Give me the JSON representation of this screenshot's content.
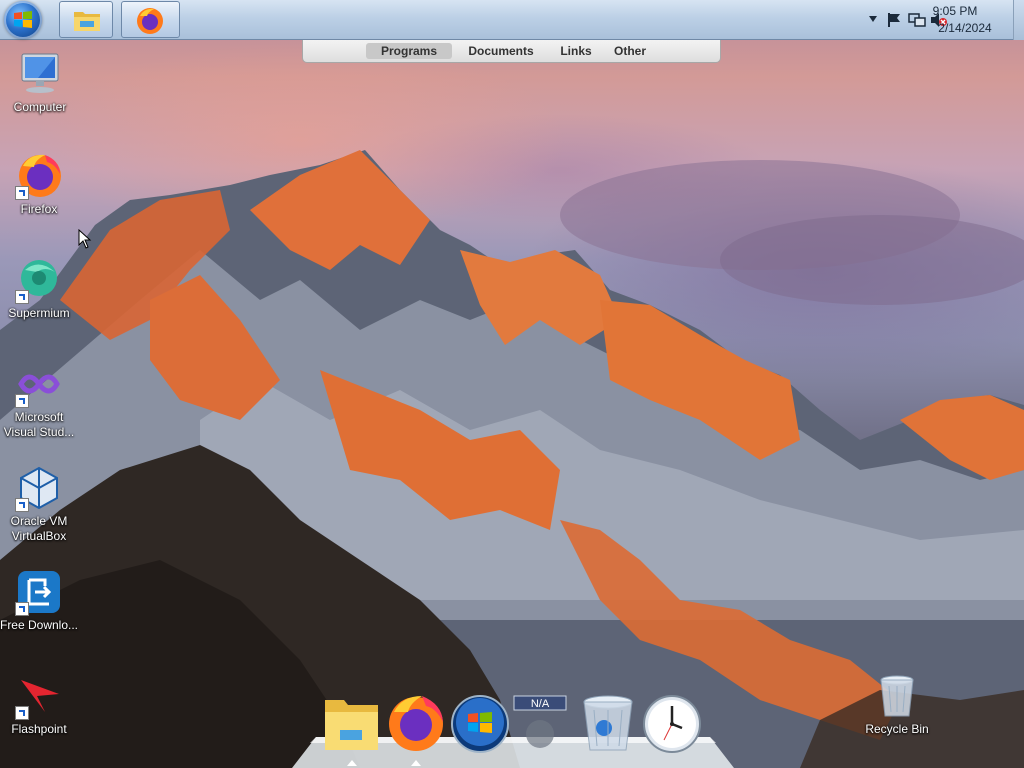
{
  "taskbar": {
    "start_button": "start-orb",
    "pinned": [
      {
        "name": "file-explorer",
        "icon": "folder-icon"
      },
      {
        "name": "firefox",
        "icon": "firefox-icon"
      }
    ],
    "tray": {
      "time": "9:05 PM",
      "date": "2/14/2024"
    }
  },
  "category_bar": {
    "tabs": [
      {
        "label": "Programs",
        "active": true
      },
      {
        "label": "Documents",
        "active": false
      },
      {
        "label": "Links",
        "active": false
      },
      {
        "label": "Other",
        "active": false
      }
    ]
  },
  "desktop_icons": [
    {
      "label": "Computer",
      "icon": "computer-icon",
      "shortcut": false
    },
    {
      "label": "Firefox",
      "icon": "firefox-icon",
      "shortcut": true
    },
    {
      "label": "Supermium",
      "icon": "supermium-icon",
      "shortcut": true
    },
    {
      "label": "Microsoft Visual Stud...",
      "icon": "visual-studio-icon",
      "shortcut": true
    },
    {
      "label": "Oracle VM VirtualBox",
      "icon": "virtualbox-icon",
      "shortcut": true
    },
    {
      "label": "Free Downlo...",
      "icon": "download-manager-icon",
      "shortcut": true
    },
    {
      "label": "Flashpoint",
      "icon": "flashpoint-icon",
      "shortcut": true
    },
    {
      "label": "Recycle Bin",
      "icon": "recycle-bin-icon",
      "shortcut": false
    }
  ],
  "dock": {
    "items": [
      {
        "name": "file-explorer",
        "icon": "folder-icon",
        "running": true
      },
      {
        "name": "firefox",
        "icon": "firefox-icon",
        "running": true
      },
      {
        "name": "start",
        "icon": "windows-orb-icon",
        "running": false
      },
      {
        "name": "network-meter",
        "icon": "network-meter-icon",
        "label": "N/A",
        "running": false
      },
      {
        "name": "recycle-bin",
        "icon": "recycle-bin-icon",
        "running": false
      },
      {
        "name": "clock",
        "icon": "clock-icon",
        "running": false
      }
    ]
  },
  "colors": {
    "taskbar": "#bcd0e6",
    "sky_pink": "#d39a97",
    "peak_orange": "#e0703a"
  }
}
